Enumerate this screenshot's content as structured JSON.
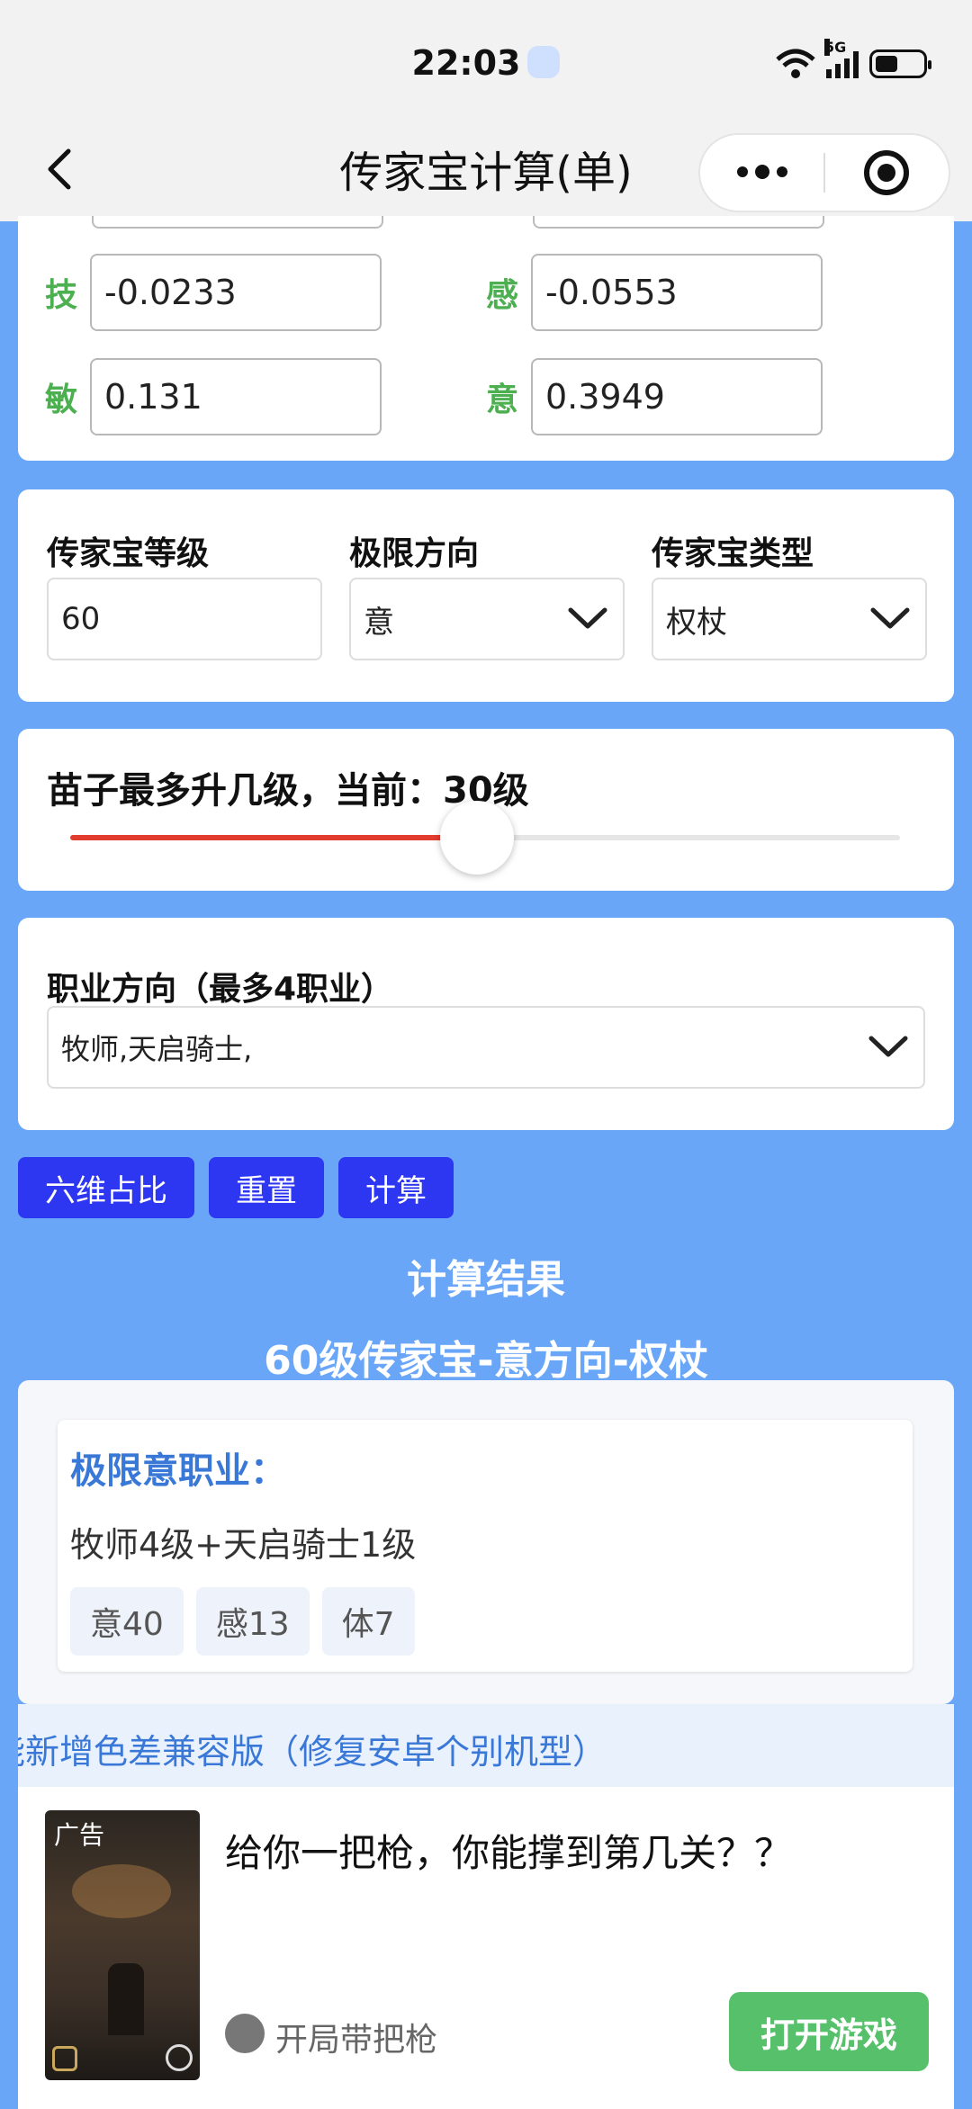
{
  "status_bar": {
    "time": "22:03",
    "network": "5G"
  },
  "nav": {
    "title": "传家宝计算(单)"
  },
  "attributes": [
    {
      "label": "技",
      "value": "-0.0233"
    },
    {
      "label": "感",
      "value": "-0.0553"
    },
    {
      "label": "敏",
      "value": "0.131"
    },
    {
      "label": "意",
      "value": "0.3949"
    }
  ],
  "settings": {
    "level_label": "传家宝等级",
    "level_value": "60",
    "direction_label": "极限方向",
    "direction_value": "意",
    "type_label": "传家宝类型",
    "type_value": "权杖"
  },
  "slider": {
    "title": "苗子最多升几级，当前：30级",
    "fraction": 0.49
  },
  "job": {
    "label": "职业方向（最多4职业）",
    "value": "牧师,天启骑士,"
  },
  "buttons": {
    "ratio": "六维占比",
    "reset": "重置",
    "calc": "计算"
  },
  "result": {
    "title": "计算结果",
    "subtitle": "60级传家宝-意方向-权杖",
    "card_title": "极限意职业：",
    "line": "牧师4级+天启骑士1级",
    "tags": [
      "意40",
      "感13",
      "体7"
    ]
  },
  "notice": "能新增色差兼容版（修复安卓个别机型）",
  "ad": {
    "badge": "广告",
    "title": "给你一把枪，你能撑到第几关？？",
    "name": "开局带把枪",
    "button": "打开游戏"
  },
  "colors": {
    "page_bg": "#6aa6f8",
    "button_bg": "#2d36f0",
    "attr_label": "#4caf50",
    "slider_fill": "#e23c2f",
    "result_accent": "#3a78d8",
    "ad_button": "#57c06a"
  }
}
